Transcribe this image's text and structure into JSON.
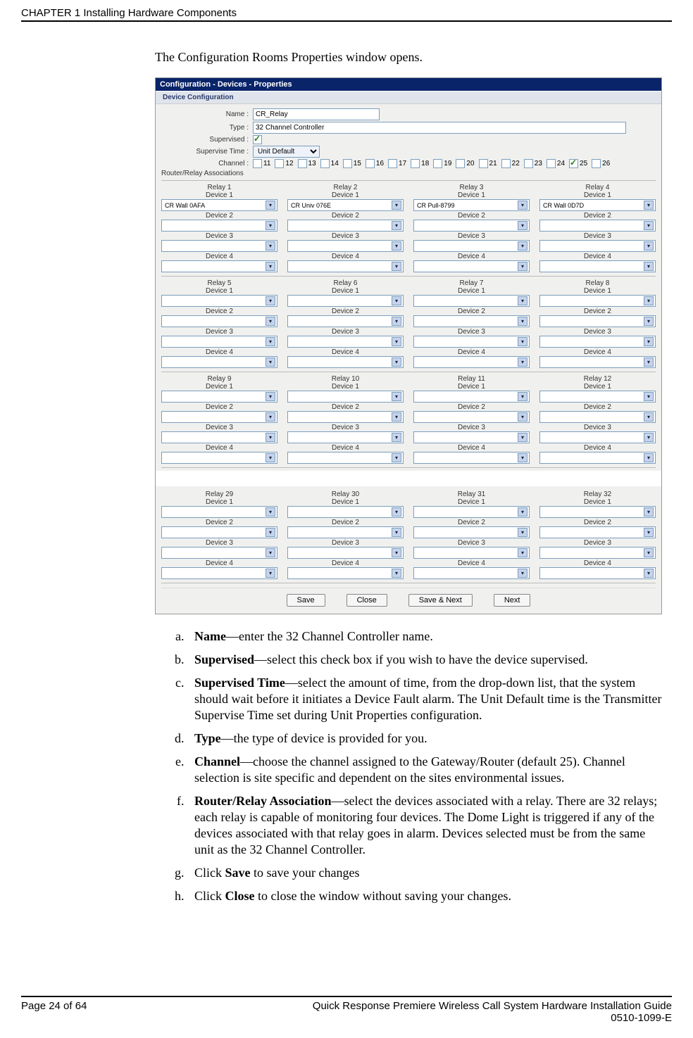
{
  "header": {
    "chapter": "CHAPTER 1 Installing Hardware Components"
  },
  "intro": "The Configuration Rooms Properties window opens.",
  "shot": {
    "title": "Configuration - Devices - Properties",
    "subtitle": "Device Configuration",
    "labels": {
      "name": "Name :",
      "type": "Type :",
      "supervised": "Supervised :",
      "supervise_time": "Supervise Time :",
      "channel": "Channel :",
      "router_section": "Router/Relay Associations"
    },
    "values": {
      "name": "CR_Relay",
      "type": "32 Channel Controller",
      "supervised_checked": true,
      "supervise_time": "Unit Default",
      "channels": [
        {
          "n": "11",
          "c": false
        },
        {
          "n": "12",
          "c": false
        },
        {
          "n": "13",
          "c": false
        },
        {
          "n": "14",
          "c": false
        },
        {
          "n": "15",
          "c": false
        },
        {
          "n": "16",
          "c": false
        },
        {
          "n": "17",
          "c": false
        },
        {
          "n": "18",
          "c": false
        },
        {
          "n": "19",
          "c": false
        },
        {
          "n": "20",
          "c": false
        },
        {
          "n": "21",
          "c": false
        },
        {
          "n": "22",
          "c": false
        },
        {
          "n": "23",
          "c": false
        },
        {
          "n": "24",
          "c": false
        },
        {
          "n": "25",
          "c": true
        },
        {
          "n": "26",
          "c": false
        }
      ]
    },
    "relay_groups": [
      [
        {
          "relay": "Relay 1",
          "d1": "CR Wall 0AFA"
        },
        {
          "relay": "Relay 2",
          "d1": "CR Univ 076E"
        },
        {
          "relay": "Relay 3",
          "d1": "CR Pull-8799"
        },
        {
          "relay": "Relay 4",
          "d1": "CR Wall 0D7D"
        }
      ],
      [
        {
          "relay": "Relay 5"
        },
        {
          "relay": "Relay 6"
        },
        {
          "relay": "Relay 7"
        },
        {
          "relay": "Relay 8"
        }
      ],
      [
        {
          "relay": "Relay 9"
        },
        {
          "relay": "Relay 10"
        },
        {
          "relay": "Relay 11"
        },
        {
          "relay": "Relay 12"
        }
      ]
    ],
    "relay_group2": [
      {
        "relay": "Relay 29"
      },
      {
        "relay": "Relay 30"
      },
      {
        "relay": "Relay 31"
      },
      {
        "relay": "Relay 32"
      }
    ],
    "dev_labels": [
      "Device 1",
      "Device 2",
      "Device 3",
      "Device 4"
    ],
    "buttons": {
      "save": "Save",
      "close": "Close",
      "save_next": "Save & Next",
      "next": "Next"
    }
  },
  "list": {
    "a": {
      "b": "Name",
      "t": "—enter the 32 Channel Controller name."
    },
    "b": {
      "b": "Supervised",
      "t": "—select this check box if you wish to have the device supervised."
    },
    "c": {
      "b": "Supervised Time",
      "t": "—select the amount of time, from the drop-down list, that the system should wait before it initiates a Device Fault alarm. The Unit Default time is the Transmitter Supervise Time set during Unit Properties configuration."
    },
    "d": {
      "b": "Type",
      "t": "—the type of device is provided for you."
    },
    "e": {
      "b": "Channel",
      "t": "—choose the channel assigned to the Gateway/Router (default 25). Channel selection is site specific and dependent on the sites environmental issues."
    },
    "f": {
      "b": "Router/Relay Association",
      "t": "—select the devices associated with a relay. There are 32 relays; each relay is capable of monitoring four devices. The Dome Light is triggered if any of the devices associated with that relay goes in alarm. Devices selected must be from the same unit as the 32 Channel Controller."
    },
    "g": {
      "pre": "Click ",
      "b": "Save",
      "t": " to save your changes"
    },
    "h": {
      "pre": "Click ",
      "b": "Close",
      "t": " to close the window without saving your changes."
    }
  },
  "footer": {
    "left": "Page 24 of 64",
    "right1": "Quick Response Premiere Wireless Call System Hardware Installation Guide",
    "right2": "0510-1099-E"
  }
}
